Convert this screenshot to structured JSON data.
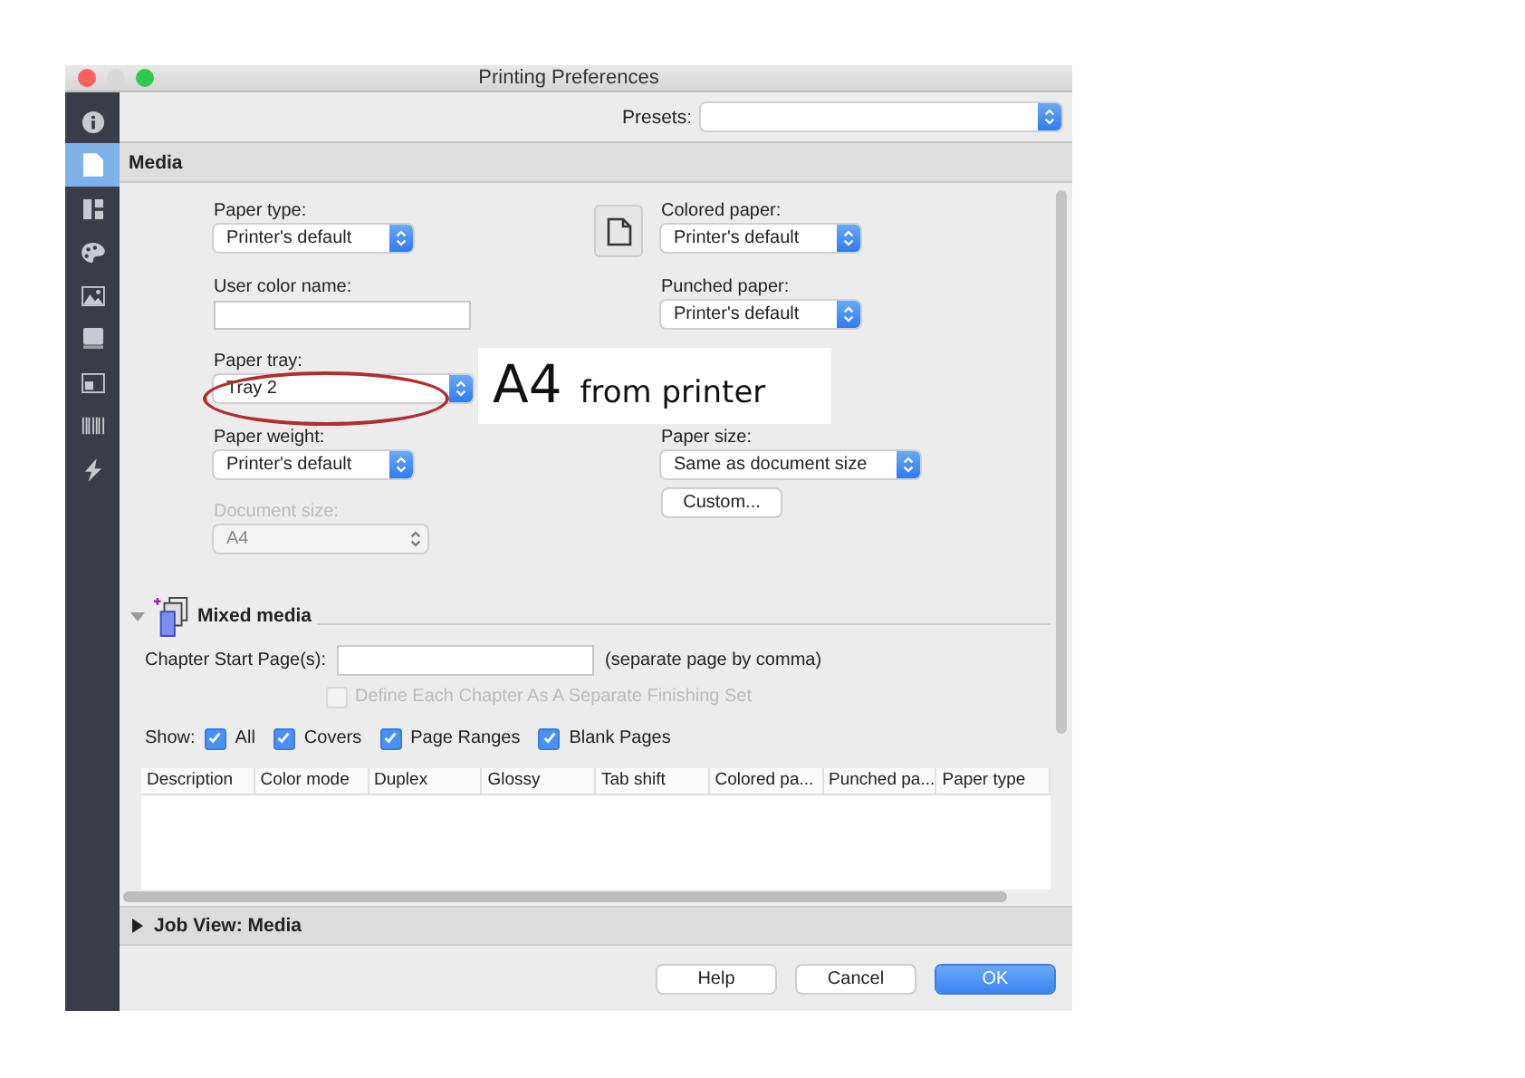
{
  "window": {
    "title": "Printing Preferences"
  },
  "sidebar": {
    "items": [
      {
        "kind": "info",
        "selected": false
      },
      {
        "kind": "page",
        "selected": true
      },
      {
        "kind": "layout",
        "selected": false
      },
      {
        "kind": "palette",
        "selected": false
      },
      {
        "kind": "image",
        "selected": false
      },
      {
        "kind": "book",
        "selected": false
      },
      {
        "kind": "window",
        "selected": false
      },
      {
        "kind": "barcode",
        "selected": false
      },
      {
        "kind": "bolt",
        "selected": false
      }
    ]
  },
  "presets": {
    "label": "Presets:"
  },
  "section": {
    "title": "Media"
  },
  "left_fields": [
    {
      "kind": "select",
      "label": "Paper type:",
      "value": "Printer's default",
      "disabled": false
    },
    {
      "kind": "text",
      "label": "User color name:"
    },
    {
      "kind": "select",
      "label": "Paper tray:",
      "value": "Tray 2",
      "disabled": false
    },
    {
      "kind": "select",
      "label": "Paper weight:",
      "value": "Printer's default",
      "disabled": false
    },
    {
      "kind": "select",
      "label": "Document size:",
      "value": "A4",
      "disabled": true
    }
  ],
  "right_fields": [
    {
      "kind": "select",
      "label": "Colored paper:",
      "value": "Printer's default",
      "disabled": false
    },
    {
      "kind": "select",
      "label": "Punched paper:",
      "value": "Printer's default",
      "disabled": false
    },
    {
      "kind": "select",
      "label": "Paper size:",
      "value": "Same as document size",
      "disabled": false
    },
    {
      "kind": "button",
      "label": "Custom..."
    }
  ],
  "mixed_media": {
    "title": "Mixed media",
    "expanded": true,
    "chapter_label": "Chapter Start Page(s):",
    "chapter_hint": "(separate page by comma)",
    "finishing": {
      "label": "Define Each Chapter As A Separate Finishing Set",
      "checked": false,
      "disabled": true
    },
    "show_label": "Show:",
    "filters": [
      {
        "label": "All",
        "checked": true
      },
      {
        "label": "Covers",
        "checked": true
      },
      {
        "label": "Page Ranges",
        "checked": true
      },
      {
        "label": "Blank Pages",
        "checked": true
      }
    ],
    "table": {
      "columns": [
        "Description",
        "Color mode",
        "Duplex",
        "Glossy",
        "Tab shift",
        "Colored pa...",
        "Punched pa...",
        "Paper type"
      ]
    }
  },
  "job_view": {
    "title": "Job View: Media",
    "expanded": false
  },
  "buttons": [
    {
      "label": "Help",
      "kind": "default"
    },
    {
      "label": "Cancel",
      "kind": "default"
    },
    {
      "label": "OK",
      "kind": "primary"
    }
  ],
  "annotation": {
    "big": "A4",
    "small": "from printer"
  }
}
